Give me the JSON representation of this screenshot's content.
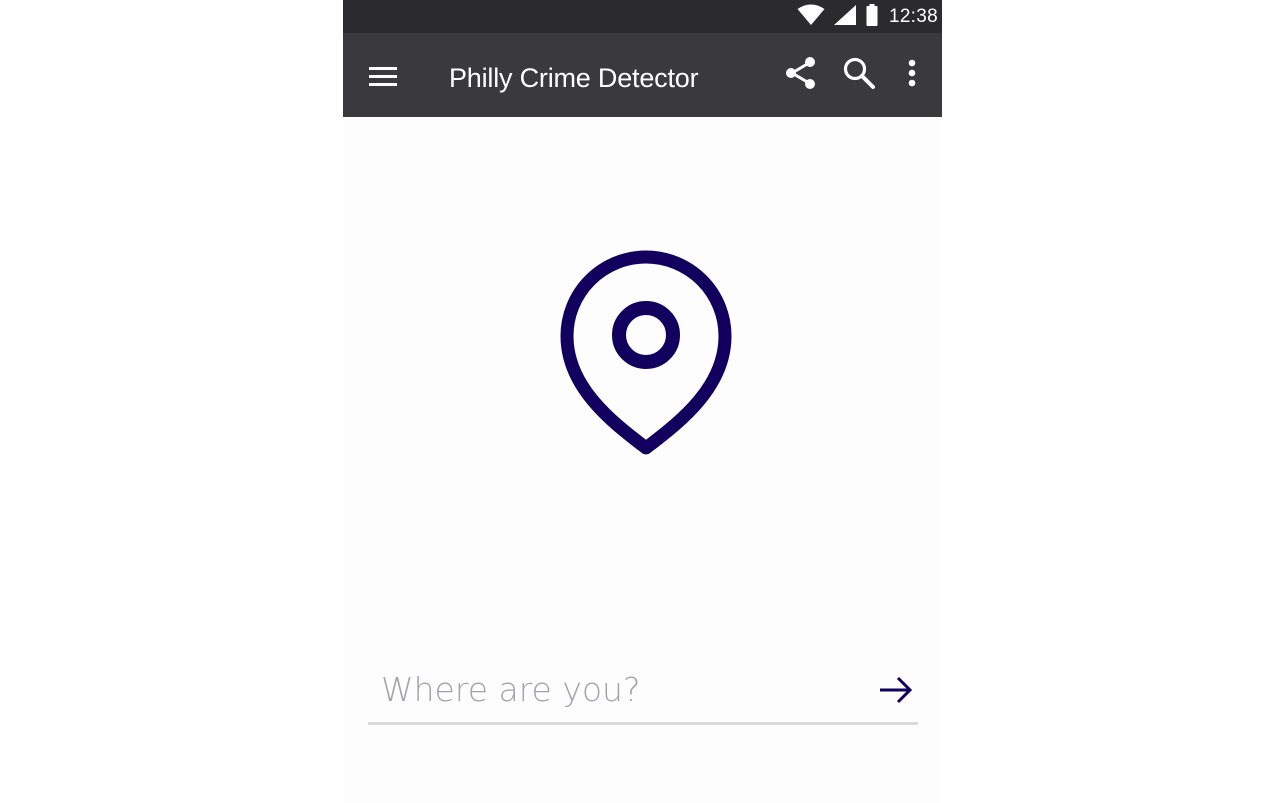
{
  "status_bar": {
    "time": "12:38",
    "icons": [
      "wifi-icon",
      "cell-signal-icon",
      "battery-icon"
    ]
  },
  "app_bar": {
    "title": "Philly Crime Detector",
    "actions": [
      "share-icon",
      "search-icon",
      "more-vert-icon"
    ],
    "nav_icon": "hamburger-menu-icon"
  },
  "main": {
    "hero_icon": "map-pin-icon",
    "search": {
      "placeholder": "Where are you?",
      "value": "",
      "submit_icon": "arrow-right-icon"
    }
  },
  "colors": {
    "status_bar": "#2b2b2d",
    "app_bar": "#3a393c",
    "accent": "#12005e",
    "placeholder": "#a3a3a8"
  }
}
